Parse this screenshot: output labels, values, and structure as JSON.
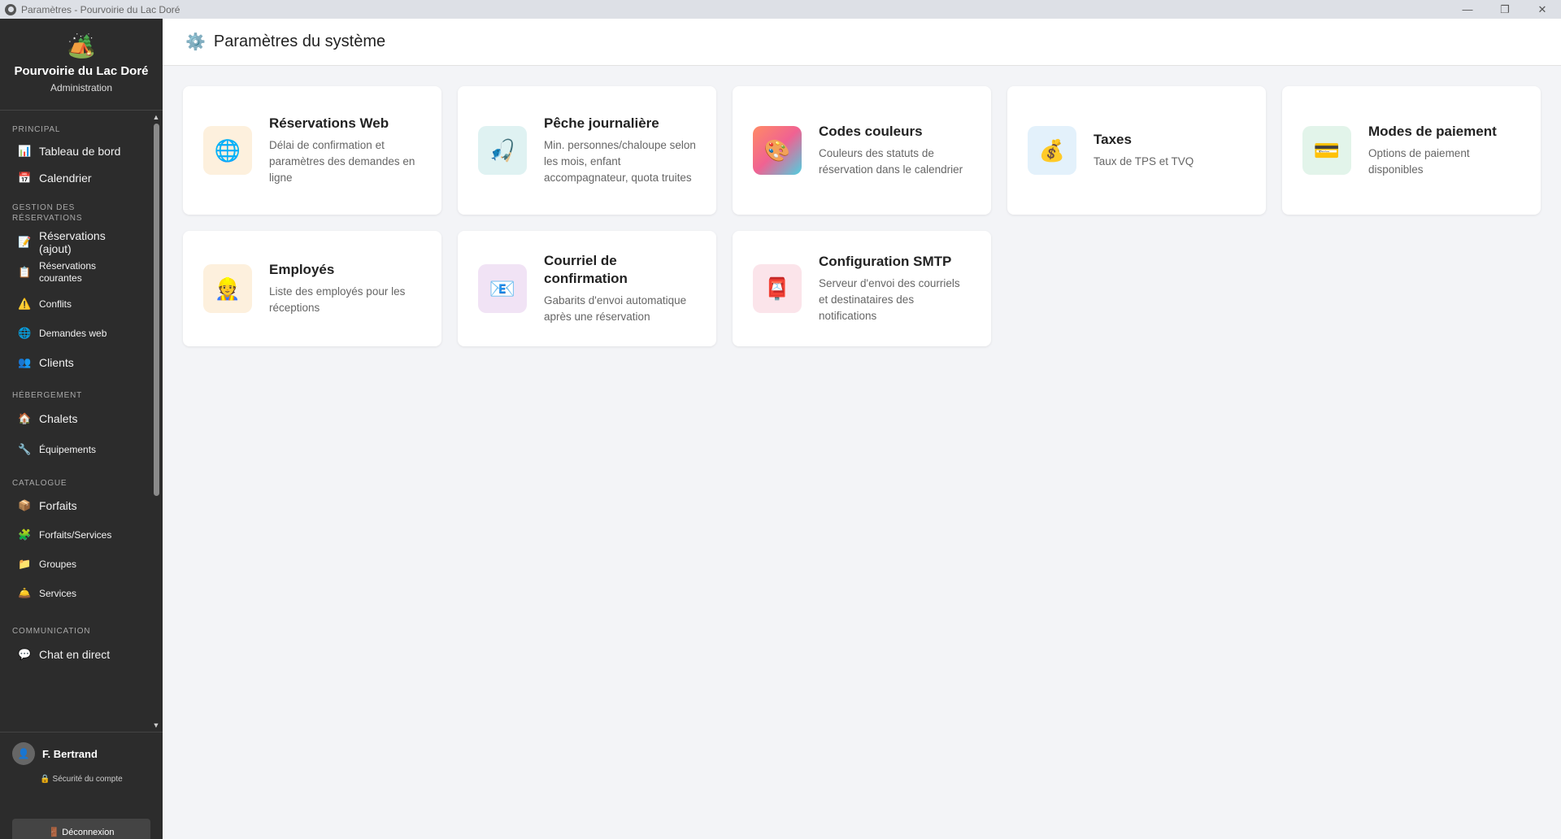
{
  "window": {
    "title": "Paramètres - Pourvoirie du Lac Doré",
    "controls": [
      "—",
      "❐",
      "✕"
    ]
  },
  "brand": {
    "logo": "🏕️",
    "name": "Pourvoirie du Lac Doré",
    "subtitle": "Administration"
  },
  "sidebar": {
    "sections": {
      "principal": "PRINCIPAL",
      "gestion": "GESTION DES RÉSERVATIONS",
      "hebergement": "HÉBERGEMENT",
      "catalogue": "CATALOGUE",
      "communication": "COMMUNICATION"
    },
    "items": {
      "tableau": {
        "icon": "📊",
        "label": "Tableau de bord"
      },
      "calendrier": {
        "icon": "📅",
        "label": "Calendrier"
      },
      "reservations_ajout": {
        "icon": "📝",
        "label": "Réservations (ajout)"
      },
      "reservations_courantes": {
        "icon": "📋",
        "label": "Réservations courantes"
      },
      "conflits": {
        "icon": "⚠️",
        "label": "Conflits"
      },
      "demandes_web": {
        "icon": "🌐",
        "label": "Demandes web"
      },
      "clients": {
        "icon": "👥",
        "label": "Clients"
      },
      "chalets": {
        "icon": "🏠",
        "label": "Chalets"
      },
      "equipements": {
        "icon": "🔧",
        "label": "Équipements"
      },
      "forfaits": {
        "icon": "📦",
        "label": "Forfaits"
      },
      "forfaits_services": {
        "icon": "🧩",
        "label": "Forfaits/Services"
      },
      "groupes": {
        "icon": "📁",
        "label": "Groupes"
      },
      "services": {
        "icon": "🛎️",
        "label": "Services"
      },
      "chat": {
        "icon": "💬",
        "label": "Chat en direct"
      }
    }
  },
  "user": {
    "avatar": "👤",
    "name": "F. Bertrand",
    "security": "🔒 Sécurité du compte",
    "logout": "🚪 Déconnexion"
  },
  "header": {
    "icon": "⚙️",
    "title": "Paramètres du système"
  },
  "cards": {
    "reservations_web": {
      "icon": "🌐",
      "title": "Réservations Web",
      "desc": "Délai de confirmation et paramètres des demandes en ligne"
    },
    "peche": {
      "icon": "🎣",
      "title": "Pêche journalière",
      "desc": "Min. personnes/chaloupe selon les mois, enfant accompagnateur, quota truites"
    },
    "codes": {
      "icon": "🎨",
      "title": "Codes couleurs",
      "desc": "Couleurs des statuts de réservation dans le calendrier"
    },
    "taxes": {
      "icon": "💰",
      "title": "Taxes",
      "desc": "Taux de TPS et TVQ"
    },
    "paiement": {
      "icon": "💳",
      "title": "Modes de paiement",
      "desc": "Options de paiement disponibles"
    },
    "employes": {
      "icon": "👷",
      "title": "Employés",
      "desc": "Liste des employés pour les réceptions"
    },
    "courriel": {
      "icon": "📧",
      "title": "Courriel de confirmation",
      "desc": "Gabarits d'envoi automatique après une réservation"
    },
    "smtp": {
      "icon": "📮",
      "title": "Configuration SMTP",
      "desc": "Serveur d'envoi des courriels et destinataires des notifications"
    }
  }
}
